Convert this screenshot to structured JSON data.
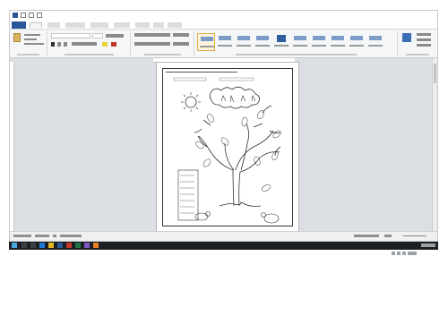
{
  "window": {
    "title": "",
    "controls": {
      "minimize": "",
      "restore": "",
      "close": ""
    }
  },
  "ribbon_tabs": [
    {
      "label": ""
    },
    {
      "label": ""
    },
    {
      "label": ""
    },
    {
      "label": ""
    },
    {
      "label": ""
    },
    {
      "label": ""
    },
    {
      "label": ""
    },
    {
      "label": ""
    },
    {
      "label": ""
    }
  ],
  "ribbon": {
    "font_name": "",
    "font_size": "",
    "styles": [
      {
        "label": "",
        "selected": true
      },
      {
        "label": ""
      },
      {
        "label": ""
      },
      {
        "label": ""
      },
      {
        "label": ""
      },
      {
        "label": ""
      },
      {
        "label": ""
      },
      {
        "label": ""
      },
      {
        "label": ""
      },
      {
        "label": ""
      }
    ]
  },
  "document": {
    "page_title": "",
    "header_fields": [
      "",
      ""
    ],
    "legend_items": [
      "",
      "",
      "",
      "",
      "",
      "",
      ""
    ]
  },
  "status_bar": {
    "page_info": "",
    "words": "",
    "language": "",
    "zoom": ""
  },
  "taskbar": {
    "time": "",
    "date": ""
  },
  "colors": {
    "word_blue": "#2b579a",
    "ribbon_bg": "#f5f6f7",
    "workspace_bg": "#dcdfe3",
    "taskbar_bg": "#1b1f24",
    "selected_style": "#fff5dc"
  }
}
